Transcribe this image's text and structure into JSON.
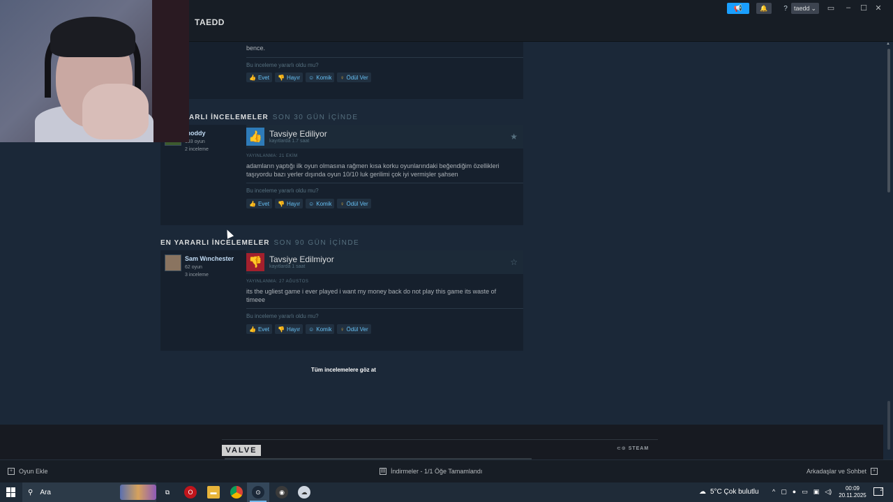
{
  "titlebar": {
    "page_title": "TAEDD",
    "username": "taedd",
    "help_label": "?"
  },
  "top_review": {
    "text_tail": "bence.",
    "helpful_question": "Bu inceleme yararlı oldu mu?",
    "buttons": {
      "yes": "Evet",
      "no": "Hayır",
      "funny": "Komik",
      "award": "Ödül Ver"
    }
  },
  "sections": [
    {
      "title": "ARLI İNCELEMELER",
      "subtitle": "SON 30 GÜN İÇİNDE"
    },
    {
      "title": "EN YARARLI İNCELEMELER",
      "subtitle": "SON 90 GÜN İÇİNDE"
    }
  ],
  "reviews": [
    {
      "author": "moddy",
      "games": "193 oyun",
      "reviews_count": "2 inceleme",
      "verdict": "Tavsiye Ediliyor",
      "verdict_type": "positive",
      "hours": "kayıtlarda 1.7 saat",
      "posted": "YAYINLANMA: 21 EKİM",
      "text": "adamların yaptığı ilk oyun olmasına rağmen kısa korku oyunlarındaki beğendiğim özellikleri taşıyordu bazı yerler dışında oyun 10/10 luk gerilimi çok iyi vermişler şahsen",
      "helpful_question": "Bu inceleme yararlı oldu mu?",
      "buttons": {
        "yes": "Evet",
        "no": "Hayır",
        "funny": "Komik",
        "award": "Ödül Ver"
      }
    },
    {
      "author": "Sam Wınchester",
      "games": "62 oyun",
      "reviews_count": "3 inceleme",
      "verdict": "Tavsiye Edilmiyor",
      "verdict_type": "negative",
      "hours": "kayıtlarda 1 saat",
      "posted": "YAYINLANMA: 27 AĞUSTOS",
      "text": "its the ugliest game i ever played i want my money back do not play this game its waste of timeee",
      "helpful_question": "Bu inceleme yararlı oldu mu?",
      "buttons": {
        "yes": "Evet",
        "no": "Hayır",
        "funny": "Komik",
        "award": "Ödül Ver"
      }
    }
  ],
  "see_all": "Tüm incelemelere göz at",
  "footer": {
    "valve": "VALVE",
    "steam": "STEAM"
  },
  "steam_bottom": {
    "add_game": "Oyun Ekle",
    "downloads": "İndirmeler - 1/1 Öğe Tamamlandı",
    "friends": "Arkadaşlar ve Sohbet"
  },
  "taskbar": {
    "search": "Ara",
    "weather": "5°C  Çok bulutlu",
    "time": "00:09",
    "date": "20.11.2025",
    "notif_count": "2"
  },
  "colors": {
    "accent": "#1a9fff",
    "link": "#66c0f4",
    "positive": "#2e7bb8",
    "negative": "#a3202d"
  }
}
